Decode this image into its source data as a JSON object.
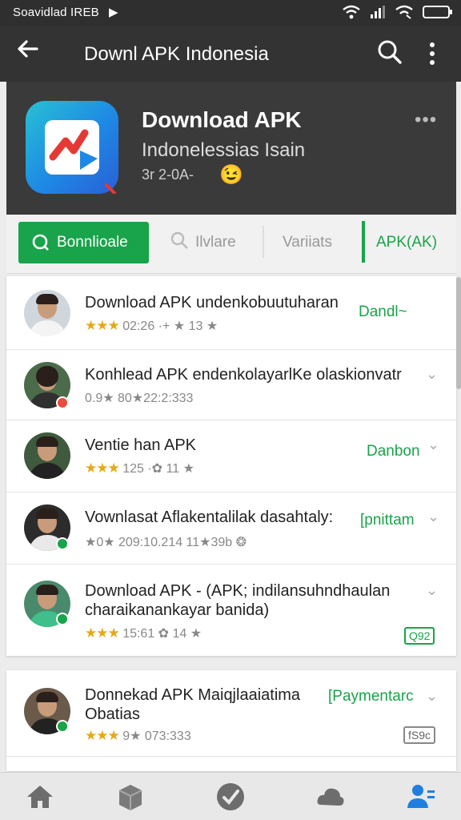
{
  "status_bar": {
    "left_text": "Soavidlad IREB",
    "play_glyph": "▶"
  },
  "app_bar": {
    "title": "Downl APK Indonesia",
    "back_icon": "arrow-back-icon",
    "search_icon": "search-icon",
    "more_icon": "more-vert-icon"
  },
  "header": {
    "title": "Download APK",
    "subtitle": "Indonelessias Isain",
    "meta": "3r 2-0A-",
    "emoji": "😉",
    "more": "•••"
  },
  "tabs": [
    {
      "label": "Bonnlioale",
      "icon": "refresh-icon",
      "active": true
    },
    {
      "label": "Ilvlare",
      "icon": "search-icon"
    },
    {
      "label": "Variiats"
    },
    {
      "label": "APK(AK)"
    }
  ],
  "list": [
    {
      "title": "Download APK undenkobuutuharan",
      "stars": "★★★",
      "meta": "02:26 ·+ ★ 13 ★",
      "action": "Dandl~",
      "chevron": ""
    },
    {
      "title": "Konhlead APK endenkolayarlKe olaskionvatr",
      "stars": "",
      "meta": "0.9★ 80★22:2:333",
      "action": "",
      "chevron": "⌄"
    },
    {
      "title": "Ventie han APK",
      "stars": "★★★",
      "meta": "125 ·✿ 11 ★",
      "action": "Danbon",
      "chevron": "⌄"
    },
    {
      "title": "Vownlasat Aflakentalilak dasahtaly:",
      "stars": "",
      "meta": "★0★ 209:10.214 11★39b ❂",
      "action": "[pnittam",
      "chevron": "⌄"
    },
    {
      "title": "Download APK - (APK; indilansuhndhaulan",
      "title2": "charaikanankayar banida)",
      "stars": "★★★",
      "meta": "15:61 ✿ 14 ★",
      "action": "",
      "chevron": "⌄",
      "tag": "Q92"
    }
  ],
  "list2": [
    {
      "title": "Donnekad APK Maiqjlaaiatima",
      "title2": "Obatias",
      "stars": "★★★",
      "meta": "9★ 073:333",
      "action": "[Paymentarc",
      "chevron": "⌄",
      "tag": "fS9c"
    }
  ],
  "bottom_nav": [
    "home-icon",
    "box-icon",
    "check-circle-icon",
    "cloud-icon",
    "account-icon"
  ],
  "colors": {
    "accent": "#19a34a",
    "header_bg": "#3a3a3a",
    "appbar_bg": "#333333",
    "star": "#e7a816"
  }
}
